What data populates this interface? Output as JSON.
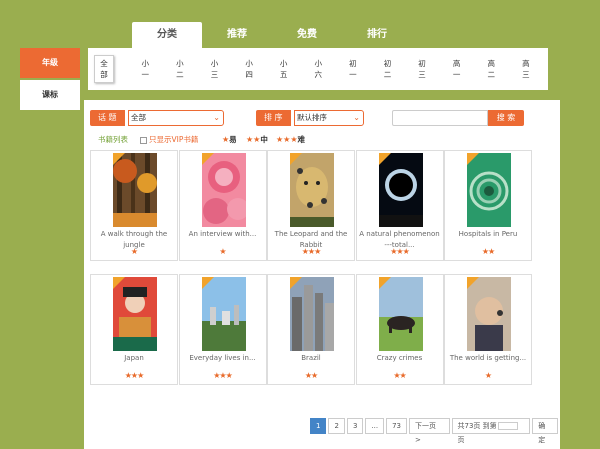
{
  "top_tabs": [
    "分类",
    "推荐",
    "免费",
    "排行"
  ],
  "side_tabs": {
    "grade": "年级",
    "course": "课标"
  },
  "grades": [
    "全部",
    "小一",
    "小二",
    "小三",
    "小四",
    "小五",
    "小六",
    "初一",
    "初二",
    "初三",
    "高一",
    "高二",
    "高三"
  ],
  "filters": {
    "topic_label": "话 题",
    "topic_value": "全部",
    "sort_label": "排 序",
    "sort_value": "默认排序",
    "search_label": "搜 索"
  },
  "legend": {
    "list_title": "书籍列表",
    "vip_only": "只显示VIP书籍",
    "easy": "易",
    "medium": "中",
    "hard": "难"
  },
  "books": [
    {
      "title": "A walk through the jungle",
      "stars": 1
    },
    {
      "title": "An interview with...",
      "stars": 1
    },
    {
      "title": "The Leopard and the Rabbit",
      "stars": 3
    },
    {
      "title": "A natural phenomenon ---total...",
      "stars": 3
    },
    {
      "title": "Hospitals in Peru",
      "stars": 2
    },
    {
      "title": "Japan",
      "stars": 3
    },
    {
      "title": "Everyday lives in...",
      "stars": 3
    },
    {
      "title": "Brazil",
      "stars": 2
    },
    {
      "title": "Crazy crimes",
      "stars": 2
    },
    {
      "title": "The world is getting...",
      "stars": 1
    }
  ],
  "pagination": {
    "pages": [
      "1",
      "2",
      "3",
      "...",
      "73"
    ],
    "next": "下一页 >",
    "total_prefix": "共73页 到第",
    "total_suffix": "页",
    "confirm": "确定"
  },
  "colors": {
    "accent": "#ec6a33",
    "background": "#9aae4f",
    "star": "#e86a2a",
    "page_active": "#4384c7"
  }
}
